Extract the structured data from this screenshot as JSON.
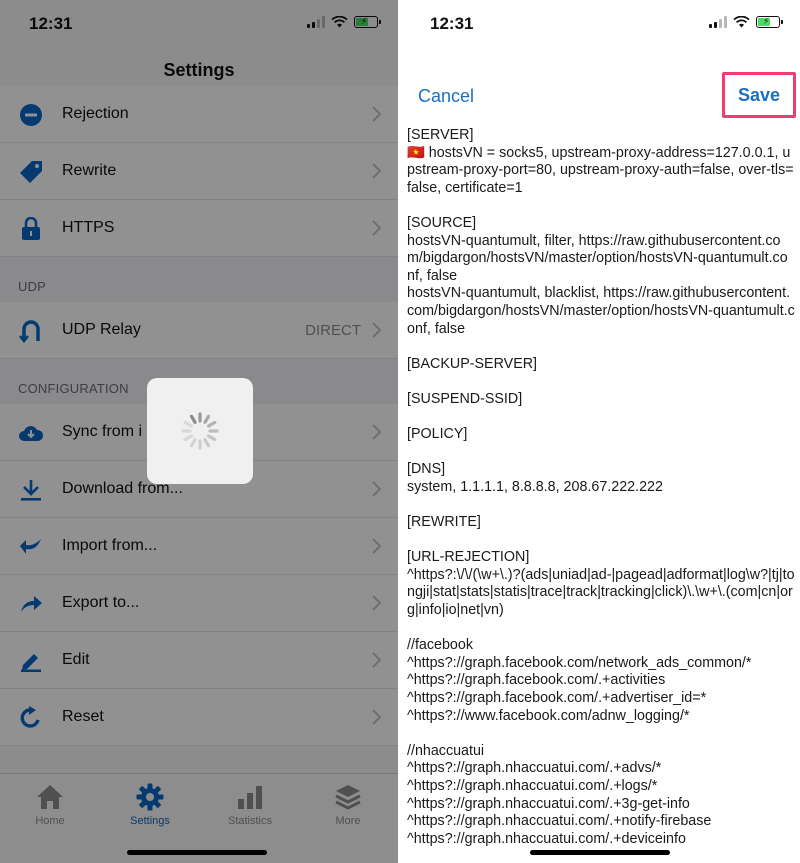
{
  "colors": {
    "accent": "#0a66c6",
    "highlight": "#f03c6e",
    "icon_blue": "#0a66c6"
  },
  "left": {
    "status": {
      "time": "12:31"
    },
    "nav_title": "Settings",
    "rows_top": [
      {
        "label": "Rejection",
        "icon": "minus-circle-icon"
      },
      {
        "label": "Rewrite",
        "icon": "tag-icon"
      },
      {
        "label": "HTTPS",
        "icon": "lock-icon"
      }
    ],
    "section_udp": "UDP",
    "udp_relay": {
      "label": "UDP Relay",
      "value": "DIRECT",
      "icon": "udp-icon"
    },
    "section_config": "CONFIGURATION",
    "rows_config": [
      {
        "label": "Sync from i",
        "icon": "cloud-download-icon"
      },
      {
        "label": "Download from...",
        "icon": "download-icon"
      },
      {
        "label": "Import from...",
        "icon": "import-arrow-icon"
      },
      {
        "label": "Export to...",
        "icon": "export-arrow-icon"
      },
      {
        "label": "Edit",
        "icon": "pencil-icon"
      },
      {
        "label": "Reset",
        "icon": "reset-icon"
      }
    ],
    "tabs": [
      {
        "label": "Home",
        "icon": "home-icon"
      },
      {
        "label": "Settings",
        "icon": "gear-icon"
      },
      {
        "label": "Statistics",
        "icon": "bar-chart-icon"
      },
      {
        "label": "More",
        "icon": "layers-icon"
      }
    ]
  },
  "right": {
    "status": {
      "time": "12:31"
    },
    "cancel_label": "Cancel",
    "save_label": "Save",
    "config_text": "[SERVER]\n🇻🇳 hostsVN = socks5, upstream-proxy-address=127.0.0.1, upstream-proxy-port=80, upstream-proxy-auth=false, over-tls=false, certificate=1\n\n[SOURCE]\nhostsVN-quantumult, filter, https://raw.githubusercontent.com/bigdargon/hostsVN/master/option/hostsVN-quantumult.conf, false\nhostsVN-quantumult, blacklist, https://raw.githubusercontent.com/bigdargon/hostsVN/master/option/hostsVN-quantumult.conf, false\n\n[BACKUP-SERVER]\n\n[SUSPEND-SSID]\n\n[POLICY]\n\n[DNS]\nsystem, 1.1.1.1, 8.8.8.8, 208.67.222.222\n\n[REWRITE]\n\n[URL-REJECTION]\n^https?:\\/\\/(\\w+\\.)?(ads|uniad|ad-|pagead|adformat|log\\w?|tj|tongji|stat|stats|statis|trace|track|tracking|click)\\.\\w+\\.(com|cn|org|info|io|net|vn)\n\n//facebook\n^https?://graph.facebook.com/network_ads_common/*\n^https?://graph.facebook.com/.+activities\n^https?://graph.facebook.com/.+advertiser_id=*\n^https?://www.facebook.com/adnw_logging/*\n\n//nhaccuatui\n^https?://graph.nhaccuatui.com/.+advs/*\n^https?://graph.nhaccuatui.com/.+logs/*\n^https?://graph.nhaccuatui.com/.+3g-get-info\n^https?://graph.nhaccuatui.com/.+notify-firebase\n^https?://graph.nhaccuatui.com/.+deviceinfo"
  }
}
